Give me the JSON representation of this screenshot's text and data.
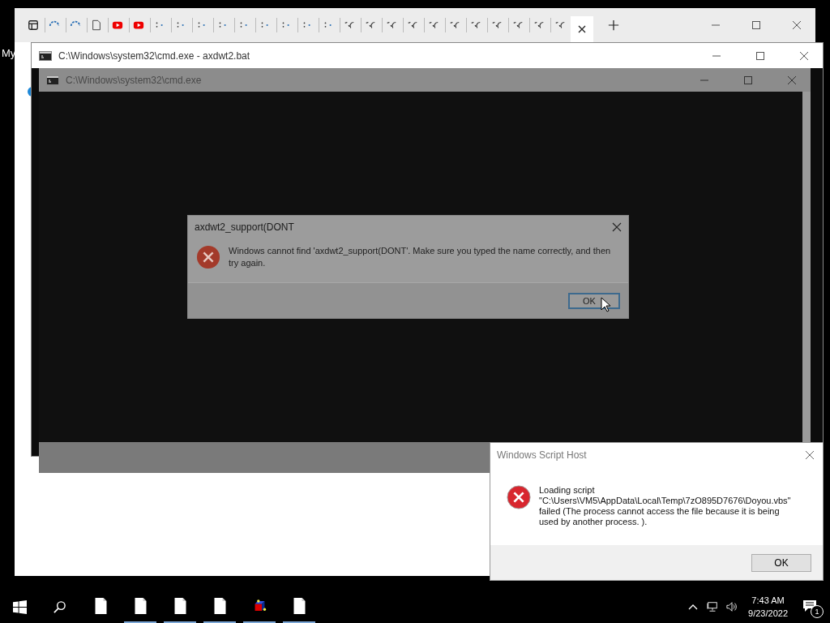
{
  "desktop": {
    "icon_label": "My"
  },
  "cmd_windows": [
    {
      "title": "C:\\Windows\\system32\\cmd.exe - axdwt2.bat",
      "dimmed": false
    },
    {
      "title": "C:\\Windows\\system32\\cmd.exe",
      "dimmed": true
    }
  ],
  "error_dialog": {
    "title": "axdwt2_support(DONT",
    "message": "Windows cannot find 'axdwt2_support(DONT'. Make sure you typed the name correctly, and then try again.",
    "button": "OK",
    "dimmed": true
  },
  "script_host_dialog": {
    "title": "Windows Script Host",
    "message_lines": [
      "Loading script",
      "\"C:\\Users\\VM5\\AppData\\Local\\Temp\\7zO895D7676\\Doyou.vbs\"",
      "failed (The process cannot access the file because it is being",
      "used by another process. )."
    ],
    "button": "OK"
  },
  "taskbar": {
    "apps": [
      {
        "kind": "file",
        "running": false
      },
      {
        "kind": "file",
        "running": true
      },
      {
        "kind": "file",
        "running": true
      },
      {
        "kind": "file",
        "running": true
      },
      {
        "kind": "cube",
        "running": true
      },
      {
        "kind": "file",
        "running": true
      }
    ],
    "time": "7:43 AM",
    "date": "9/23/2022",
    "notification_count": "1"
  }
}
